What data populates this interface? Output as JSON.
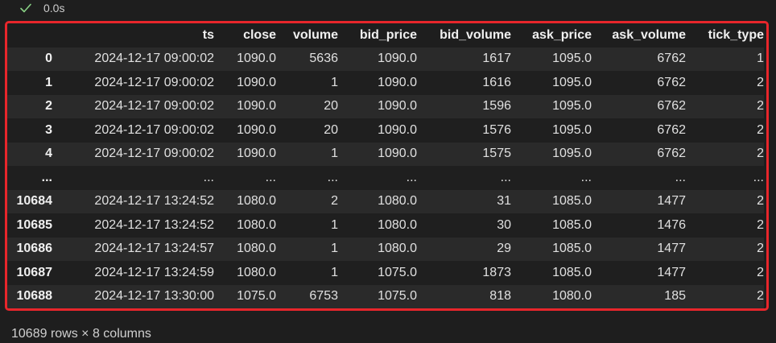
{
  "cell_status": {
    "icon": "check-icon",
    "icon_color": "#89d185",
    "exec_time": "0.0s"
  },
  "highlight_color": "#e8262b",
  "table": {
    "columns": [
      "",
      "ts",
      "close",
      "volume",
      "bid_price",
      "bid_volume",
      "ask_price",
      "ask_volume",
      "tick_type"
    ],
    "rows": [
      [
        "0",
        "2024-12-17 09:00:02",
        "1090.0",
        "5636",
        "1090.0",
        "1617",
        "1095.0",
        "6762",
        "1"
      ],
      [
        "1",
        "2024-12-17 09:00:02",
        "1090.0",
        "1",
        "1090.0",
        "1616",
        "1095.0",
        "6762",
        "2"
      ],
      [
        "2",
        "2024-12-17 09:00:02",
        "1090.0",
        "20",
        "1090.0",
        "1596",
        "1095.0",
        "6762",
        "2"
      ],
      [
        "3",
        "2024-12-17 09:00:02",
        "1090.0",
        "20",
        "1090.0",
        "1576",
        "1095.0",
        "6762",
        "2"
      ],
      [
        "4",
        "2024-12-17 09:00:02",
        "1090.0",
        "1",
        "1090.0",
        "1575",
        "1095.0",
        "6762",
        "2"
      ],
      [
        "...",
        "...",
        "...",
        "...",
        "...",
        "...",
        "...",
        "...",
        "..."
      ],
      [
        "10684",
        "2024-12-17 13:24:52",
        "1080.0",
        "2",
        "1080.0",
        "31",
        "1085.0",
        "1477",
        "2"
      ],
      [
        "10685",
        "2024-12-17 13:24:52",
        "1080.0",
        "1",
        "1080.0",
        "30",
        "1085.0",
        "1476",
        "2"
      ],
      [
        "10686",
        "2024-12-17 13:24:57",
        "1080.0",
        "1",
        "1080.0",
        "29",
        "1085.0",
        "1477",
        "2"
      ],
      [
        "10687",
        "2024-12-17 13:24:59",
        "1080.0",
        "1",
        "1075.0",
        "1873",
        "1085.0",
        "1477",
        "2"
      ],
      [
        "10688",
        "2024-12-17 13:30:00",
        "1075.0",
        "6753",
        "1075.0",
        "818",
        "1080.0",
        "185",
        "2"
      ]
    ]
  },
  "footer": {
    "shape": "10689 rows × 8 columns"
  }
}
